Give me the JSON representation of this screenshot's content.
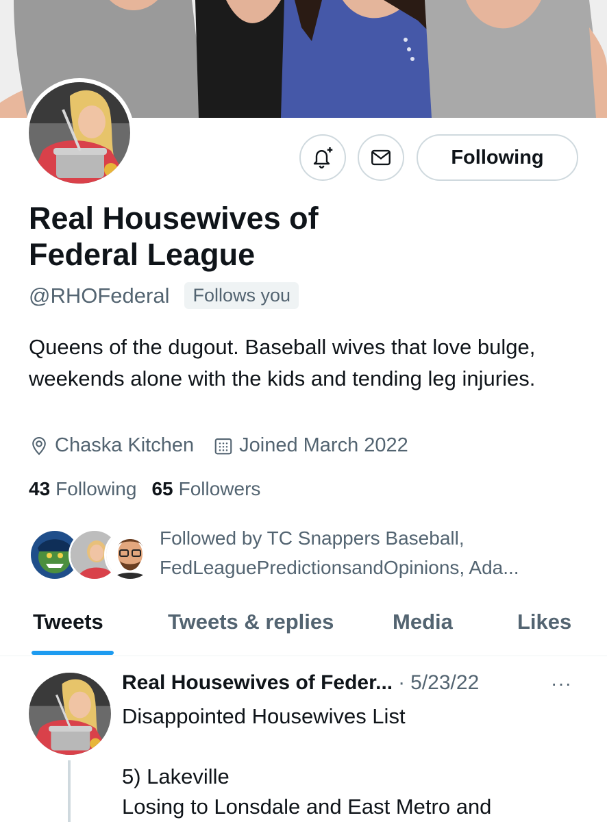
{
  "profile": {
    "display_name": "Real Housewives of Federal League",
    "handle": "@RHOFederal",
    "follows_you": "Follows you",
    "bio": "Queens of the dugout. Baseball wives that love bulge, weekends alone with the kids and tending leg injuries.",
    "location": "Chaska Kitchen",
    "joined": "Joined March 2022",
    "following_count": "43",
    "following_label": "Following",
    "followers_count": "65",
    "followers_label": "Followers",
    "followed_by": "Followed by TC Snappers Baseball, FedLeaguePredictionsandOpinions, Ada..."
  },
  "actions": {
    "notify_icon": "bell-plus-icon",
    "message_icon": "envelope-icon",
    "following_button": "Following"
  },
  "tabs": [
    {
      "label": "Tweets",
      "active": true
    },
    {
      "label": "Tweets & replies",
      "active": false
    },
    {
      "label": "Media",
      "active": false
    },
    {
      "label": "Likes",
      "active": false
    }
  ],
  "tweet": {
    "author": "Real Housewives of Feder...",
    "separator": "·",
    "date": "5/23/22",
    "more": "···",
    "text": "Disappointed Housewives List\n\n5) Lakeville\nLosing to Lonsdale and East Metro and"
  },
  "colors": {
    "accent": "#1d9bf0",
    "text_primary": "#0f1419",
    "text_secondary": "#536471",
    "border": "#cfd9de"
  }
}
